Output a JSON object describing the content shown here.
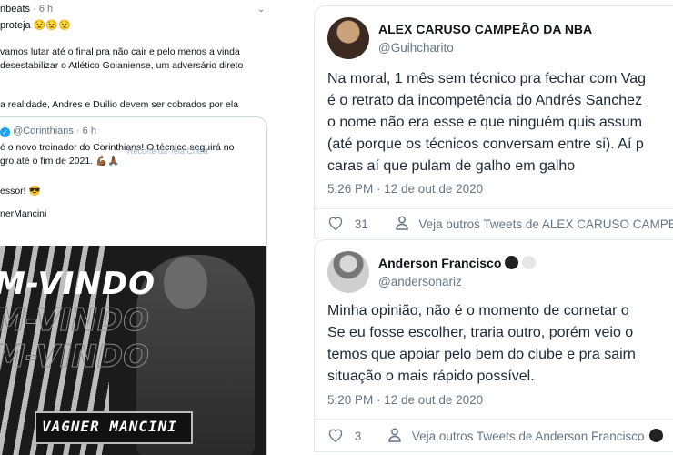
{
  "left_tweet": {
    "user_partial": "nbeats",
    "time": "6 h",
    "line1": "proteja 😟😟😟",
    "text": [
      "vamos lutar até o final pra não cair e pelo menos a vinda",
      "desestabilizar o Atlético Goianiense, um adversário direto",
      ""
    ],
    "text3": "a realidade, Andres e Duílio devem ser cobrados por ela",
    "quoted": {
      "handle": "@Corinthians",
      "time": "6 h",
      "lines": [
        "é o novo treinador do Corinthians! O técnico seguirá no",
        "gro até o fim de 2021. 💪🏾🙏🏾"
      ],
      "overlay": "Recorte da Tela Cheia",
      "line3": "essor! 😎",
      "line4": "nerMancini",
      "banner": "M-VINDO",
      "nameplate": "VAGNER MANCINI"
    }
  },
  "tweets": [
    {
      "name": "ALEX CARUSO CAMPEÃO DA NBA",
      "handle": "@Guihcharito",
      "body": [
        "Na moral, 1 mês sem técnico pra fechar com Vag",
        "é o retrato da incompetência do Andrés Sanchez",
        "o nome não era esse e que ninguém quis assum",
        "(até porque os técnicos conversam entre si). Aí p",
        "caras aí que pulam de galho em galho"
      ],
      "timestamp": "5:26 PM · 12 de out de 2020",
      "likes": "31",
      "see_more": "Veja outros Tweets de ALEX CARUSO CAMPEÃ"
    },
    {
      "name": "Anderson Francisco",
      "handle": "@andersonariz",
      "body": [
        "Minha opinião, não é o momento de cornetar o",
        "Se eu fosse escolher, traria outro, porém veio o",
        "temos que apoiar pelo bem do clube e pra sairn",
        "situação o mais rápido possível."
      ],
      "timestamp": "5:20 PM · 12 de out de 2020",
      "likes": "3",
      "see_more": "Veja outros Tweets de Anderson Francisco"
    }
  ],
  "icons": [
    "heart-icon",
    "person-icon",
    "verified-icon",
    "chevron-down-icon"
  ],
  "colors": {
    "link_gray": "#657786",
    "verified_blue": "#1da1f2"
  }
}
